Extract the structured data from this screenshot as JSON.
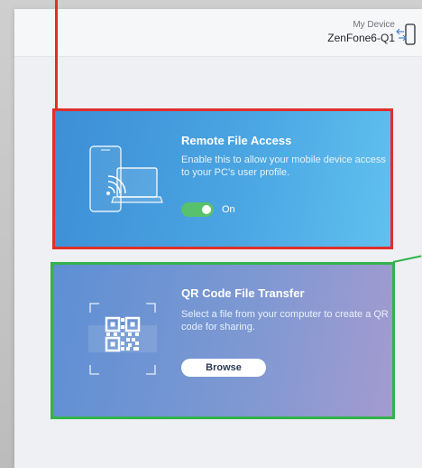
{
  "device": {
    "caption": "My Device",
    "name": "ZenFone6-Q1"
  },
  "remote_access": {
    "title": "Remote File Access",
    "description": "Enable this to allow your mobile device access to your PC's user profile.",
    "toggle_state": "On",
    "toggle_on": true
  },
  "qr_transfer": {
    "title": "QR Code File Transfer",
    "description": "Select a file from your computer to create a QR code for sharing.",
    "browse_label": "Browse"
  },
  "colors": {
    "annotation_red": "#e02f2a",
    "annotation_green": "#34b24b",
    "toggle_on": "#58c16b"
  },
  "icons": {
    "device_switch": "phone-arrows-icon",
    "remote_illustration": "phone-laptop-wireless-icon",
    "qr_illustration": "qr-code-icon"
  }
}
